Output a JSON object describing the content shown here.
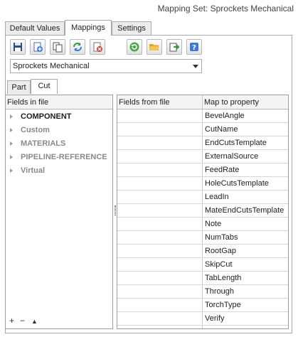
{
  "header": {
    "title": "Mapping Set: Sprockets Mechanical"
  },
  "tabs": [
    {
      "label": "Default Values",
      "active": false
    },
    {
      "label": "Mappings",
      "active": true
    },
    {
      "label": "Settings",
      "active": false
    }
  ],
  "toolbar": {
    "buttons": [
      {
        "icon": "save-icon"
      },
      {
        "icon": "add-icon"
      },
      {
        "icon": "copy-icon"
      },
      {
        "icon": "refresh-icon"
      },
      {
        "icon": "delete-icon"
      },
      {
        "icon": "reload-icon"
      },
      {
        "icon": "open-folder-icon"
      },
      {
        "icon": "export-icon"
      },
      {
        "icon": "help-icon"
      }
    ]
  },
  "mapping_select": {
    "value": "Sprockets Mechanical"
  },
  "subtabs": [
    {
      "label": "Part",
      "active": false
    },
    {
      "label": "Cut",
      "active": true
    }
  ],
  "fields_in_file": {
    "header": "Fields in file",
    "items": [
      {
        "label": "COMPONENT",
        "color": "#1e1e1e"
      },
      {
        "label": "Custom",
        "color": "#8a8a8a"
      },
      {
        "label": "MATERIALS",
        "color": "#8a8a8a"
      },
      {
        "label": "PIPELINE-REFERENCE",
        "color": "#8a8a8a"
      },
      {
        "label": "Virtual",
        "color": "#8a8a8a"
      }
    ],
    "controls": {
      "add": "+",
      "remove": "−",
      "up": "▲"
    }
  },
  "mapping_grid": {
    "col_file": "Fields from file",
    "col_property": "Map to property",
    "rows": [
      {
        "file": "",
        "property": "BevelAngle"
      },
      {
        "file": "",
        "property": "CutName"
      },
      {
        "file": "",
        "property": "EndCutsTemplate"
      },
      {
        "file": "",
        "property": "ExternalSource"
      },
      {
        "file": "",
        "property": "FeedRate"
      },
      {
        "file": "",
        "property": "HoleCutsTemplate"
      },
      {
        "file": "",
        "property": "LeadIn"
      },
      {
        "file": "",
        "property": "MateEndCutsTemplate"
      },
      {
        "file": "",
        "property": "Note"
      },
      {
        "file": "",
        "property": "NumTabs"
      },
      {
        "file": "",
        "property": "RootGap"
      },
      {
        "file": "",
        "property": "SkipCut"
      },
      {
        "file": "",
        "property": "TabLength"
      },
      {
        "file": "",
        "property": "Through"
      },
      {
        "file": "",
        "property": "TorchType"
      },
      {
        "file": "",
        "property": "Verify"
      }
    ]
  }
}
